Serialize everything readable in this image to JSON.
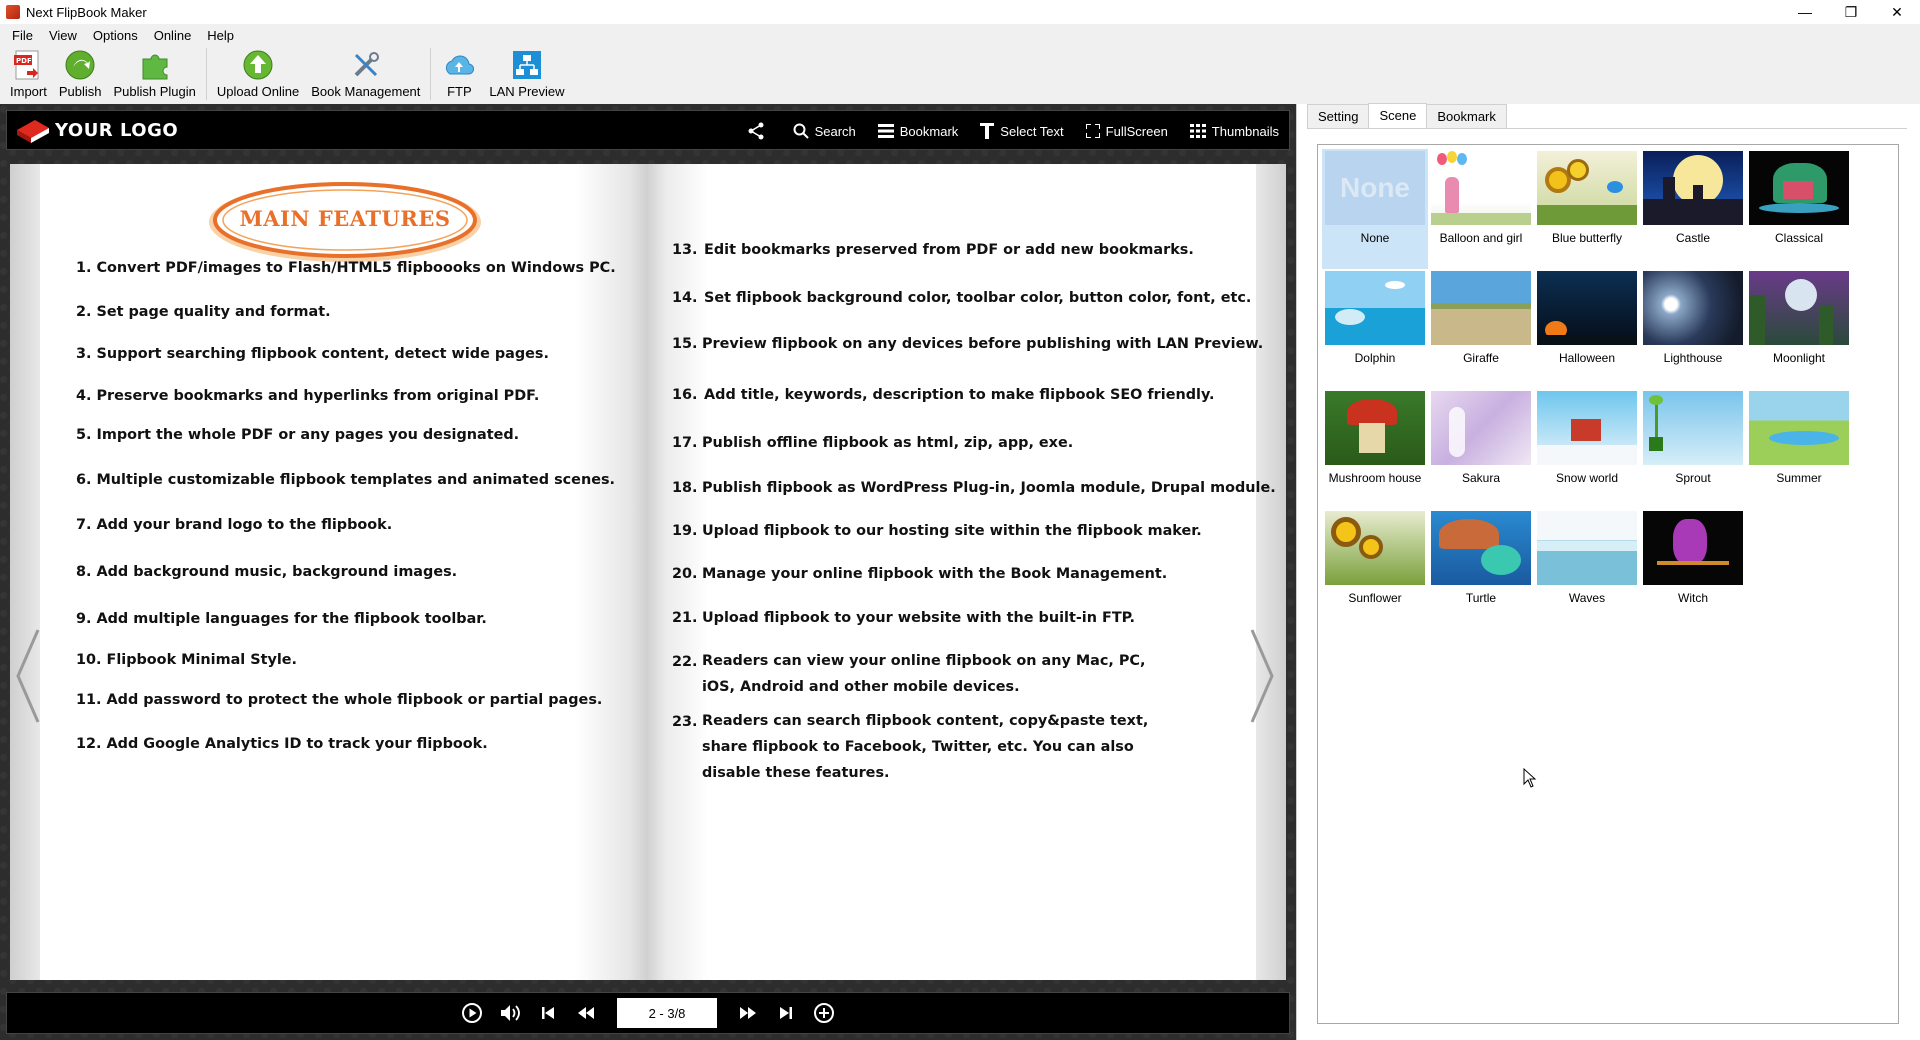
{
  "window": {
    "title": "Next FlipBook Maker",
    "minimize": "—",
    "maximize": "❐",
    "close": "✕"
  },
  "menu": [
    "File",
    "View",
    "Options",
    "Online",
    "Help"
  ],
  "toolbar": {
    "import": "Import",
    "publish": "Publish",
    "publish_plugin": "Publish Plugin",
    "upload_online": "Upload Online",
    "book_management": "Book Management",
    "ftp": "FTP",
    "lan_preview": "LAN Preview"
  },
  "flipbook": {
    "logo_text": "YOUR LOGO",
    "tools": {
      "search": "Search",
      "bookmark": "Bookmark",
      "select_text": "Select Text",
      "fullscreen": "FullScreen",
      "thumbnails": "Thumbnails"
    },
    "badge_title": "MAIN FEATURES",
    "left_features": [
      "1. Convert PDF/images to Flash/HTML5 flipboooks on Windows PC.",
      "2. Set page quality and format.",
      "3. Support searching flipbook content, detect wide pages.",
      "4. Preserve bookmarks and hyperlinks from original PDF.",
      "5. Import the whole PDF or any pages you designated.",
      "6. Multiple customizable flipbook templates and animated scenes.",
      "7. Add your brand logo to the flipbook.",
      "8. Add background music, background images.",
      "9. Add multiple languages for the flipbook toolbar.",
      "10. Flipbook Minimal Style.",
      "11. Add password to protect the whole flipbook or partial pages.",
      "12. Add Google Analytics ID to track your flipbook."
    ],
    "right_features": [
      {
        "num": "13.",
        "text": "Edit bookmarks preserved from PDF or add new bookmarks."
      },
      {
        "num": "14.",
        "text": "Set flipbook background color, toolbar color, button color, font, etc."
      },
      {
        "num": "15.",
        "text": "Preview flipbook on any devices before publishing with LAN Preview."
      },
      {
        "num": "16.",
        "text": "Add  title, keywords, description to make flipbook SEO friendly."
      },
      {
        "num": "17.",
        "text": "Publish offline flipbook as html, zip, app, exe."
      },
      {
        "num": "18.",
        "text": "Publish flipbook as WordPress Plug-in, Joomla module, Drupal module."
      },
      {
        "num": "19.",
        "text": "Upload flipbook to our hosting site within the flipbook maker."
      },
      {
        "num": "20.",
        "text": "Manage your online flipbook with the Book Management."
      },
      {
        "num": "21.",
        "text": "Upload flipbook to your website with the built-in FTP."
      },
      {
        "num": "22.",
        "text": "Readers can view your online flipbook on any Mac, PC, iOS, Android and other mobile devices."
      },
      {
        "num": "23.",
        "text": "Readers can search flipbook content, copy&paste text, share flipbook to Facebook, Twitter, etc. You can also disable these features."
      }
    ],
    "page_indicator": "2 - 3/8"
  },
  "side_panel": {
    "tabs": [
      "Setting",
      "Scene",
      "Bookmark"
    ],
    "active_tab": "Scene",
    "none_thumb_text": "None",
    "scenes": [
      "None",
      "Balloon and girl",
      "Blue butterfly",
      "Castle",
      "Classical",
      "Dolphin",
      "Giraffe",
      "Halloween",
      "Lighthouse",
      "Moonlight",
      "Mushroom house",
      "Sakura",
      "Snow world",
      "Sprout",
      "Summer",
      "Sunflower",
      "Turtle",
      "Waves",
      "Witch"
    ],
    "selected_scene": "None"
  },
  "colors": {
    "accent_orange": "#e8702a",
    "selection": "#cce4f7",
    "book_bg": "#2d2d2d"
  }
}
